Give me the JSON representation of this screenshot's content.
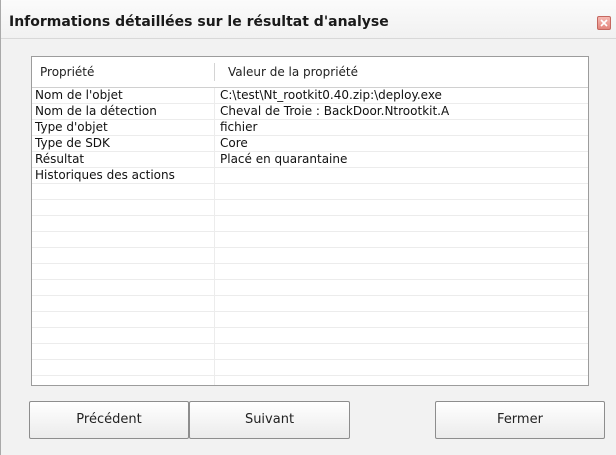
{
  "window": {
    "title": "Informations détaillées sur le résultat d'analyse"
  },
  "table": {
    "headers": [
      "Propriété",
      "Valeur de la propriété"
    ],
    "rows": [
      [
        "Nom de l'objet",
        "C:\\test\\Nt_rootkit0.40.zip:\\deploy.exe"
      ],
      [
        "Nom de la détection",
        "Cheval de Troie : BackDoor.Ntrootkit.A"
      ],
      [
        "Type d'objet",
        "fichier"
      ],
      [
        "Type de SDK",
        "Core"
      ],
      [
        "Résultat",
        "Placé en quarantaine"
      ],
      [
        "Historiques des actions",
        ""
      ],
      [
        "",
        ""
      ],
      [
        "",
        ""
      ],
      [
        "",
        ""
      ],
      [
        "",
        ""
      ],
      [
        "",
        ""
      ],
      [
        "",
        ""
      ],
      [
        "",
        ""
      ],
      [
        "",
        ""
      ],
      [
        "",
        ""
      ],
      [
        "",
        ""
      ],
      [
        "",
        ""
      ],
      [
        "",
        ""
      ]
    ]
  },
  "buttons": {
    "previous": "Précédent",
    "next": "Suivant",
    "close": "Fermer"
  },
  "icons": {
    "close": "close-icon"
  }
}
